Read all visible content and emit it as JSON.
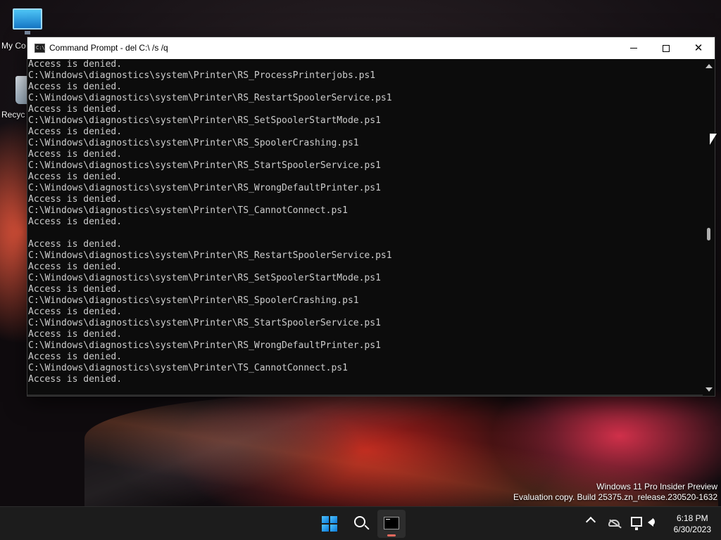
{
  "desktop": {
    "icons": [
      {
        "label": "My Co",
        "icon": "monitor-icon"
      },
      {
        "label": "Recyc",
        "icon": "recycle-bin-icon"
      }
    ],
    "watermark": {
      "line1": "Windows 11 Pro Insider Preview",
      "line2": "Evaluation copy. Build 25375.zn_release.230520-1632"
    }
  },
  "window": {
    "title": "Command Prompt - del  C:\\ /s /q",
    "app_icon_text": "C:\\_",
    "buttons": {
      "minimize": "minimize-icon",
      "maximize": "maximize-icon",
      "close": "✕"
    }
  },
  "console": {
    "lines": [
      "Access is denied.",
      "C:\\Windows\\diagnostics\\system\\Printer\\RS_ProcessPrinterjobs.ps1",
      "Access is denied.",
      "C:\\Windows\\diagnostics\\system\\Printer\\RS_RestartSpoolerService.ps1",
      "Access is denied.",
      "C:\\Windows\\diagnostics\\system\\Printer\\RS_SetSpoolerStartMode.ps1",
      "Access is denied.",
      "C:\\Windows\\diagnostics\\system\\Printer\\RS_SpoolerCrashing.ps1",
      "Access is denied.",
      "C:\\Windows\\diagnostics\\system\\Printer\\RS_StartSpoolerService.ps1",
      "Access is denied.",
      "C:\\Windows\\diagnostics\\system\\Printer\\RS_WrongDefaultPrinter.ps1",
      "Access is denied.",
      "C:\\Windows\\diagnostics\\system\\Printer\\TS_CannotConnect.ps1",
      "Access is denied.",
      "",
      "Access is denied.",
      "C:\\Windows\\diagnostics\\system\\Printer\\RS_RestartSpoolerService.ps1",
      "Access is denied.",
      "C:\\Windows\\diagnostics\\system\\Printer\\RS_SetSpoolerStartMode.ps1",
      "Access is denied.",
      "C:\\Windows\\diagnostics\\system\\Printer\\RS_SpoolerCrashing.ps1",
      "Access is denied.",
      "C:\\Windows\\diagnostics\\system\\Printer\\RS_StartSpoolerService.ps1",
      "Access is denied.",
      "C:\\Windows\\diagnostics\\system\\Printer\\RS_WrongDefaultPrinter.ps1",
      "Access is denied.",
      "C:\\Windows\\diagnostics\\system\\Printer\\TS_CannotConnect.ps1",
      "Access is denied."
    ],
    "scroll_position": 0.5
  },
  "taskbar": {
    "pinned": [
      {
        "name": "start",
        "icon": "windows-logo-icon"
      },
      {
        "name": "search",
        "icon": "search-icon"
      },
      {
        "name": "command-prompt",
        "icon": "command-prompt-icon",
        "running": true
      }
    ],
    "tray": {
      "icons": [
        "chevron-up-icon",
        "onedrive-offline-icon",
        "network-icon",
        "volume-icon"
      ],
      "time": "6:18 PM",
      "date": "6/30/2023"
    }
  },
  "colors": {
    "console_bg": "#0c0c0c",
    "console_text": "#cccccc",
    "titlebar_bg": "#ffffff",
    "taskbar_bg": "#1c1c1c",
    "running_indicator": "#f06a5e"
  }
}
